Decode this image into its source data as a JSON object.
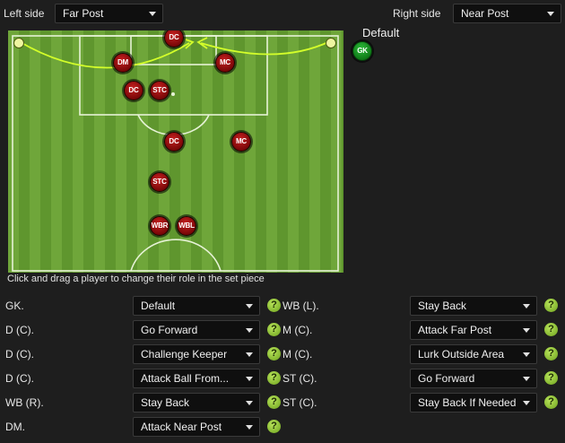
{
  "header": {
    "left_label": "Left side",
    "left_value": "Far Post",
    "right_label": "Right side",
    "right_value": "Near Post",
    "default_label": "Default"
  },
  "pitch": {
    "hint": "Click and drag a player to change their role in the set piece",
    "players": [
      {
        "label": "DC"
      },
      {
        "label": "DM"
      },
      {
        "label": "MC"
      },
      {
        "label": "DC"
      },
      {
        "label": "STC"
      },
      {
        "label": "DC"
      },
      {
        "label": "MC"
      },
      {
        "label": "STC"
      },
      {
        "label": "WBR"
      },
      {
        "label": "WBL"
      }
    ],
    "gk_label": "GK"
  },
  "roles": {
    "left": [
      {
        "position": "GK.",
        "role": "Default"
      },
      {
        "position": "D (C).",
        "role": "Go Forward"
      },
      {
        "position": "D (C).",
        "role": "Challenge Keeper"
      },
      {
        "position": "D (C).",
        "role": "Attack Ball From..."
      },
      {
        "position": "WB (R).",
        "role": "Stay Back"
      },
      {
        "position": "DM.",
        "role": "Attack Near Post"
      }
    ],
    "right": [
      {
        "position": "WB (L).",
        "role": "Stay Back"
      },
      {
        "position": "M (C).",
        "role": "Attack Far Post"
      },
      {
        "position": "M (C).",
        "role": "Lurk Outside Area"
      },
      {
        "position": "ST (C).",
        "role": "Go Forward"
      },
      {
        "position": "ST (C).",
        "role": "Stay Back If Needed"
      }
    ],
    "help_glyph": "?"
  },
  "colors": {
    "accent_arrow": "#d4ff2a",
    "player_red": "#b01515",
    "gk_green": "#1a9a28",
    "help_green": "#8cc63f"
  }
}
